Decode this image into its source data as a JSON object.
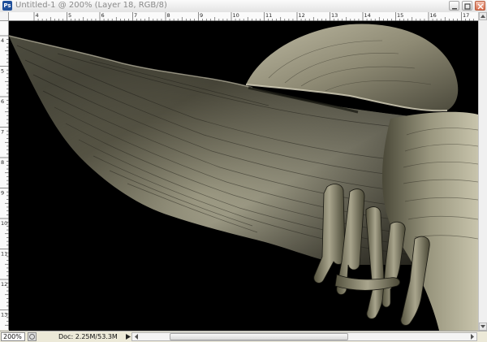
{
  "window": {
    "title": "Untitled-1 @ 200% (Layer 18, RGB/8)",
    "app_icon_text": "Ps",
    "buttons": [
      "minimize",
      "maximize",
      "close"
    ]
  },
  "rulers": {
    "horizontal_labels": [
      "4",
      "5",
      "6",
      "7",
      "8",
      "9",
      "10",
      "11",
      "12",
      "13",
      "14",
      "15",
      "16",
      "17"
    ],
    "vertical_labels": [
      "4",
      "5",
      "6",
      "7",
      "8",
      "9",
      "10",
      "11",
      "12",
      "13"
    ]
  },
  "status_bar": {
    "zoom": "200%",
    "doc_info": "Doc: 2.25M/53.3M"
  },
  "colors": {
    "canvas_background": "#000000",
    "chrome": "#ece9d8",
    "close_button": "#d86b49"
  },
  "icons": {
    "app": "photoshop-icon",
    "status": "status-info-icon",
    "arrow": "triangle-right-icon"
  }
}
